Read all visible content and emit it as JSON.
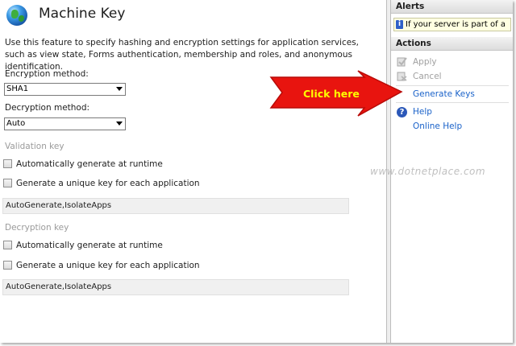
{
  "main": {
    "title": "Machine Key",
    "description": "Use this feature to specify hashing and encryption settings for application services, such as view state, Forms authentication, membership and roles, and anonymous identification.",
    "encryption_label": "Encryption method:",
    "encryption_value": "SHA1",
    "decryption_label": "Decryption method:",
    "decryption_value": "Auto",
    "validation": {
      "header": "Validation key",
      "auto_generate": "Automatically generate at runtime",
      "unique_key": "Generate a unique key for each application",
      "value": "AutoGenerate,IsolateApps"
    },
    "decryption": {
      "header": "Decryption key",
      "auto_generate": "Automatically generate at runtime",
      "unique_key": "Generate a unique key for each application",
      "value": "AutoGenerate,IsolateApps"
    }
  },
  "annotation": {
    "callout_text": "Click here",
    "callout_color": "#e8140f",
    "callout_text_color": "#ffff00"
  },
  "alerts": {
    "header": "Alerts",
    "message": "If your server is part of a"
  },
  "actions": {
    "header": "Actions",
    "apply": "Apply",
    "cancel": "Cancel",
    "generate_keys": "Generate Keys",
    "help": "Help",
    "online_help": "Online Help"
  },
  "watermark": "www.dotnetplace.com"
}
